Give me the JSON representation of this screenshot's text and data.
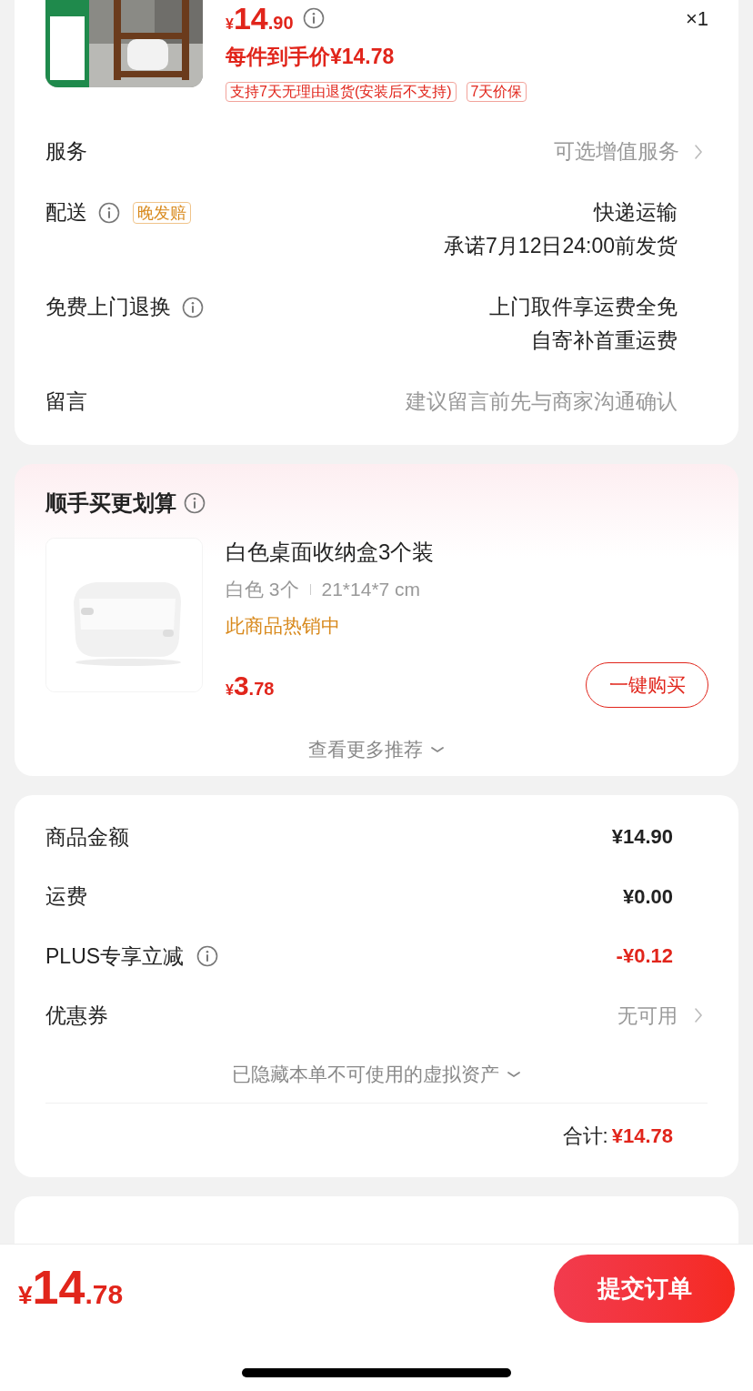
{
  "product": {
    "currency": "¥",
    "price_int": "14",
    "price_dec": ".90",
    "quantity": "×1",
    "final_price": "每件到手价¥14.78",
    "tags": [
      "支持7天无理由退货(安装后不支持)",
      "7天价保"
    ]
  },
  "order_rows": [
    {
      "label": "服务",
      "kind": "link",
      "info": false,
      "values": [
        "可选增值服务"
      ]
    },
    {
      "label": "配送",
      "kind": "plain",
      "info": true,
      "badge": "晚发赔",
      "values": [
        "快递运输",
        "承诺7月12日24:00前发货"
      ]
    },
    {
      "label": "免费上门退换",
      "kind": "plain",
      "info": true,
      "values": [
        "上门取件享运费全免",
        "自寄补首重运费"
      ]
    },
    {
      "label": "留言",
      "kind": "hint",
      "info": false,
      "values": [
        "建议留言前先与商家沟通确认"
      ]
    }
  ],
  "recommend": {
    "title": "顺手买更划算",
    "info": true,
    "item": {
      "name": "白色桌面收纳盒3个装",
      "specs": [
        "白色 3个",
        "21*14*7 cm"
      ],
      "status": "此商品热销中",
      "currency": "¥",
      "price_int": "3",
      "price_dec": ".78",
      "button": "一键购买"
    },
    "more": "查看更多推荐"
  },
  "summary": {
    "rows": [
      {
        "label": "商品金额",
        "kind": "amount",
        "info": false,
        "value": "¥14.90"
      },
      {
        "label": "运费",
        "kind": "amount",
        "info": false,
        "value": "¥0.00"
      },
      {
        "label": "PLUS专享立减",
        "kind": "discount",
        "info": true,
        "value": "-¥0.12"
      },
      {
        "label": "优惠券",
        "kind": "link",
        "info": false,
        "value": "无可用"
      }
    ],
    "hidden_note": "已隐藏本单不可使用的虚拟资产",
    "total_label": "合计:",
    "total": "¥14.78"
  },
  "bottom_bar": {
    "currency": "¥",
    "total_int": "14",
    "total_dec": ".78",
    "submit": "提交订单"
  }
}
